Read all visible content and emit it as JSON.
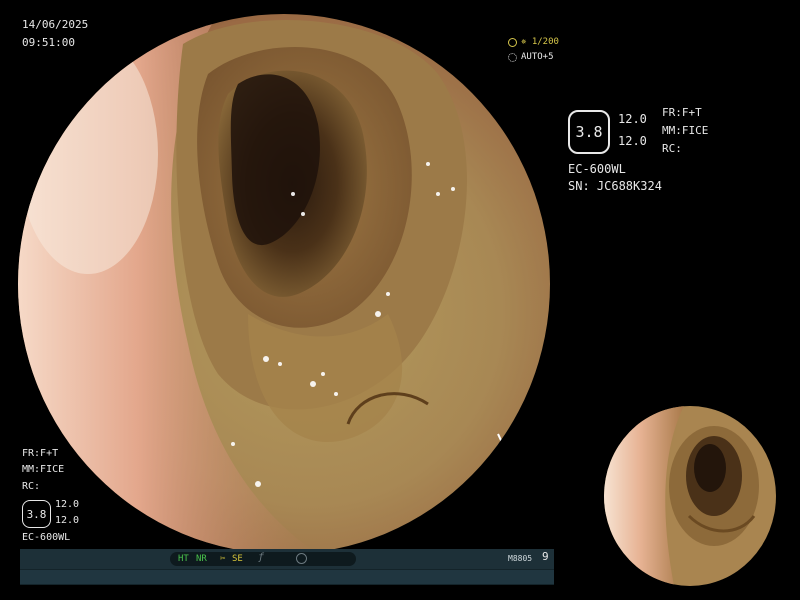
{
  "overlay_left_top": {
    "date": "14/06/2025",
    "time": "09:51:00"
  },
  "exposure": {
    "shutter": "✵ 1/200",
    "auto": "AUTO+5",
    "shutter_icon": "target-icon",
    "auto_icon": "iris-icon",
    "color": "#d6c64b"
  },
  "settings_right": {
    "hex_value": "3.8",
    "val1": "12.0",
    "val2": "12.0",
    "fr": "FR:F+T",
    "mm": "MM:FICE",
    "rc": "RC:",
    "model": "EC-600WL",
    "serial": "SN: JC688K324"
  },
  "settings_left_bottom": {
    "fr": "FR:F+T",
    "mm": "MM:FICE",
    "rc": "RC:",
    "hex_value": "3.8",
    "val1": "12.0",
    "val2": "12.0",
    "model": "EC-600WL"
  },
  "status_bar": {
    "ht": "HT",
    "nr": "NR",
    "se": "SE",
    "se_icon": "scissors-icon",
    "f_icon": "f-stop-icon",
    "record_icon": "record-icon",
    "code": "M8805",
    "number": "9",
    "accent": "#49c24b",
    "accent2": "#d7c53a"
  }
}
